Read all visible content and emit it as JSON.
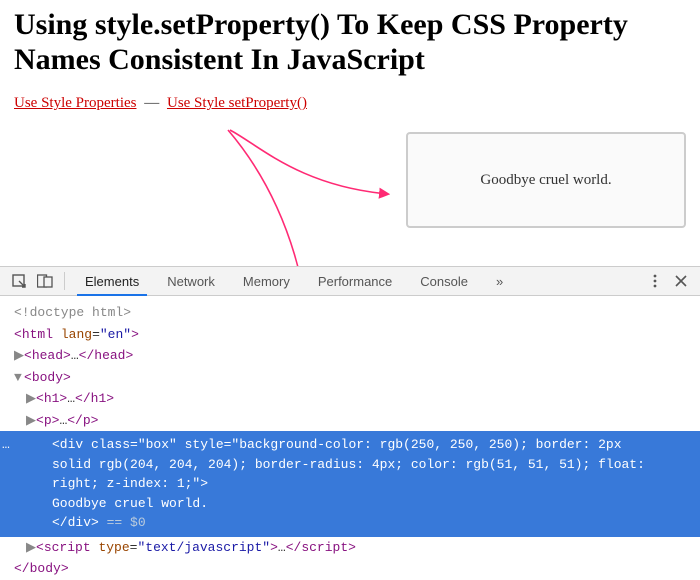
{
  "page": {
    "title": "Using style.setProperty() To Keep CSS Property Names Consistent In JavaScript",
    "link1": "Use Style Properties",
    "separator": "—",
    "link2": "Use Style setProperty()",
    "box_text": "Goodbye cruel world."
  },
  "devtools": {
    "tabs": {
      "elements": "Elements",
      "network": "Network",
      "memory": "Memory",
      "performance": "Performance",
      "console": "Console"
    },
    "code": {
      "doctype": "<!doctype html>",
      "html_open": "<html lang=\"en\">",
      "head": "<head>…</head>",
      "body_open": "<body>",
      "h1": "<h1>…</h1>",
      "p": "<p>…</p>",
      "sel_line1": "<div class=\"box\" style=\"background-color: rgb(250, 250, 250); border: 2px",
      "sel_line2": "solid rgb(204, 204, 204); border-radius: 4px; color: rgb(51, 51, 51); float:",
      "sel_line3": "right; z-index: 1;\">",
      "sel_line4": "    Goodbye cruel world.",
      "sel_line5": "</div>",
      "eq0": " == $0",
      "script": "<script type=\"text/javascript\">…</",
      "script2": "script>",
      "body_close": "</body>",
      "dots": "…"
    }
  }
}
